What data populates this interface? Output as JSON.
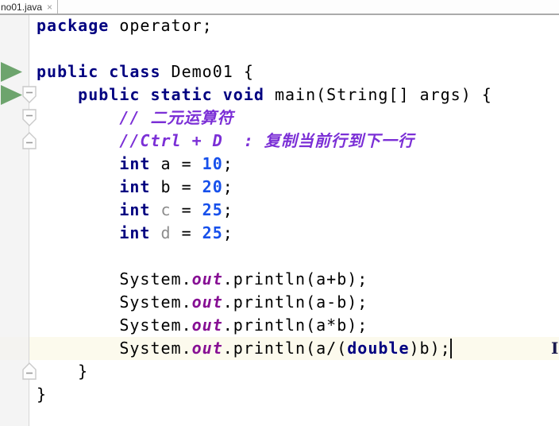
{
  "tab": {
    "title": "no01.java",
    "close_label": "×"
  },
  "editor": {
    "language": "java",
    "right_edge_partial_text": "I",
    "colors": {
      "keyword": "#000080",
      "plain": "#000000",
      "number": "#1750eb",
      "comment": "#7b2fd6",
      "static_field": "#871094",
      "unused_variable": "#8c8c8c",
      "current_line_background": "#fcfaed",
      "gutter_background": "#f1f1f1",
      "run_arrow": "#6da46d"
    },
    "gutter": {
      "run_arrow_lines": [
        2,
        3
      ],
      "fold_markers": [
        {
          "line": 3,
          "dir": "down"
        },
        {
          "line": 4,
          "dir": "down"
        },
        {
          "line": 5,
          "dir": "up"
        },
        {
          "line": 15,
          "dir": "up"
        }
      ]
    },
    "caret": {
      "line_index": 14
    },
    "lines": [
      {
        "segments": [
          {
            "text": "package",
            "style": "keyword"
          },
          {
            "text": " operator;",
            "style": "plain"
          }
        ]
      },
      {
        "segments": []
      },
      {
        "segments": [
          {
            "text": "public class",
            "style": "keyword"
          },
          {
            "text": " Demo01 {",
            "style": "plain"
          }
        ]
      },
      {
        "segments": [
          {
            "text": "    ",
            "style": "plain"
          },
          {
            "text": "public static void",
            "style": "keyword"
          },
          {
            "text": " main(String[] args) {",
            "style": "plain"
          }
        ]
      },
      {
        "segments": [
          {
            "text": "        ",
            "style": "plain"
          },
          {
            "text": "// 二元运算符",
            "style": "comment"
          }
        ]
      },
      {
        "segments": [
          {
            "text": "        ",
            "style": "plain"
          },
          {
            "text": "//Ctrl + D  : 复制当前行到下一行",
            "style": "comment"
          }
        ]
      },
      {
        "segments": [
          {
            "text": "        ",
            "style": "plain"
          },
          {
            "text": "int",
            "style": "keyword"
          },
          {
            "text": " a = ",
            "style": "plain"
          },
          {
            "text": "10",
            "style": "number"
          },
          {
            "text": ";",
            "style": "plain"
          }
        ]
      },
      {
        "segments": [
          {
            "text": "        ",
            "style": "plain"
          },
          {
            "text": "int",
            "style": "keyword"
          },
          {
            "text": " b = ",
            "style": "plain"
          },
          {
            "text": "20",
            "style": "number"
          },
          {
            "text": ";",
            "style": "plain"
          }
        ]
      },
      {
        "segments": [
          {
            "text": "        ",
            "style": "plain"
          },
          {
            "text": "int",
            "style": "keyword"
          },
          {
            "text": " ",
            "style": "plain"
          },
          {
            "text": "c",
            "style": "unused"
          },
          {
            "text": " = ",
            "style": "plain"
          },
          {
            "text": "25",
            "style": "number"
          },
          {
            "text": ";",
            "style": "plain"
          }
        ]
      },
      {
        "segments": [
          {
            "text": "        ",
            "style": "plain"
          },
          {
            "text": "int",
            "style": "keyword"
          },
          {
            "text": " ",
            "style": "plain"
          },
          {
            "text": "d",
            "style": "unused"
          },
          {
            "text": " = ",
            "style": "plain"
          },
          {
            "text": "25",
            "style": "number"
          },
          {
            "text": ";",
            "style": "plain"
          }
        ]
      },
      {
        "segments": []
      },
      {
        "segments": [
          {
            "text": "        System.",
            "style": "plain"
          },
          {
            "text": "out",
            "style": "field"
          },
          {
            "text": ".println(a+b);",
            "style": "plain"
          }
        ]
      },
      {
        "segments": [
          {
            "text": "        System.",
            "style": "plain"
          },
          {
            "text": "out",
            "style": "field"
          },
          {
            "text": ".println(a-b);",
            "style": "plain"
          }
        ]
      },
      {
        "segments": [
          {
            "text": "        System.",
            "style": "plain"
          },
          {
            "text": "out",
            "style": "field"
          },
          {
            "text": ".println(a*b);",
            "style": "plain"
          }
        ]
      },
      {
        "segments": [
          {
            "text": "        System.",
            "style": "plain"
          },
          {
            "text": "out",
            "style": "field"
          },
          {
            "text": ".println(a/(",
            "style": "plain"
          },
          {
            "text": "double",
            "style": "keyword"
          },
          {
            "text": ")b);",
            "style": "plain"
          }
        ]
      },
      {
        "segments": [
          {
            "text": "    }",
            "style": "plain"
          }
        ]
      },
      {
        "segments": [
          {
            "text": "}",
            "style": "plain"
          }
        ]
      }
    ]
  }
}
